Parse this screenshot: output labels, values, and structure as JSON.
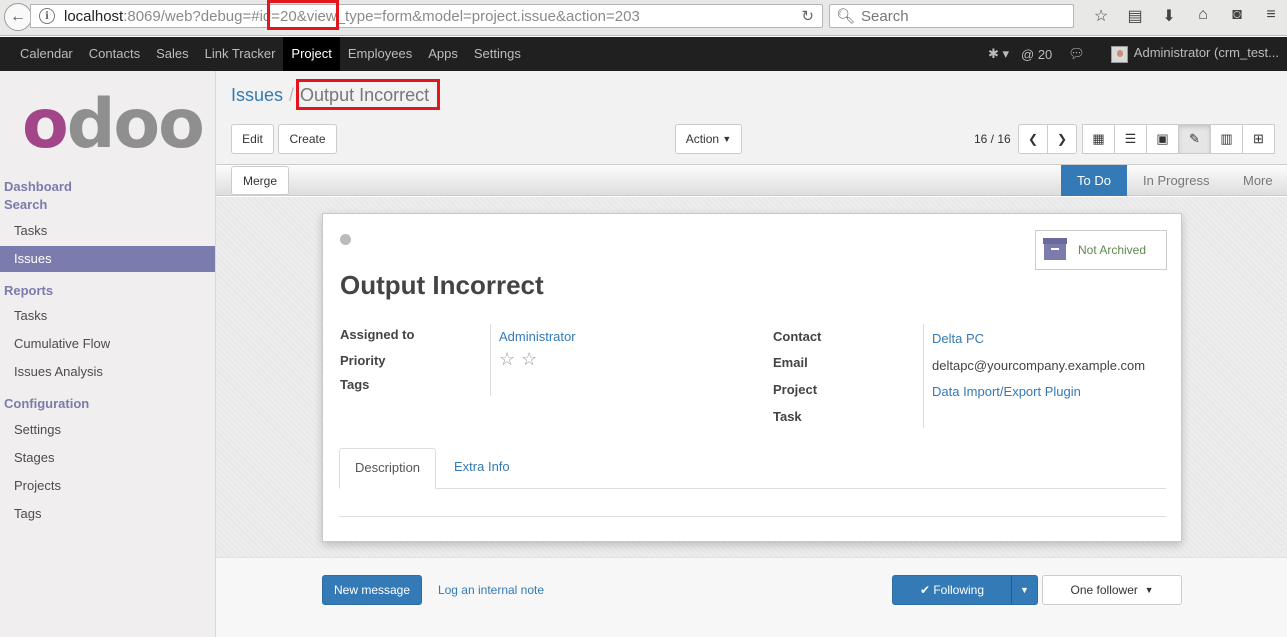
{
  "browser": {
    "url_host": "localhost",
    "url_rest": ":8069/web?debug=#id=20&view_type=form&model=project.issue&action=203",
    "search_placeholder": "Search"
  },
  "topnav": {
    "items": [
      "Calendar",
      "Contacts",
      "Sales",
      "Link Tracker",
      "Project",
      "Employees",
      "Apps",
      "Settings"
    ],
    "active": "Project",
    "message_count": "20",
    "user": "Administrator (crm_test..."
  },
  "sidebar": {
    "logo_first": "o",
    "logo_rest": "doo",
    "dashboard": "Dashboard",
    "search": "Search",
    "search_items": [
      "Tasks",
      "Issues"
    ],
    "reports": "Reports",
    "report_items": [
      "Tasks",
      "Cumulative Flow",
      "Issues Analysis"
    ],
    "configuration": "Configuration",
    "config_items": [
      "Settings",
      "Stages",
      "Projects",
      "Tags"
    ]
  },
  "breadcrumb": {
    "parent": "Issues",
    "sep": "/",
    "current": "Output Incorrect"
  },
  "buttons": {
    "edit": "Edit",
    "create": "Create",
    "action": "Action",
    "merge": "Merge"
  },
  "pager": "16 / 16",
  "stages": [
    "To Do",
    "In Progress",
    "More"
  ],
  "record": {
    "archive_label": "Not Archived",
    "title": "Output Incorrect",
    "labels": {
      "assigned_to": "Assigned to",
      "priority": "Priority",
      "tags": "Tags",
      "contact": "Contact",
      "email": "Email",
      "project": "Project",
      "task": "Task"
    },
    "assigned_to": "Administrator",
    "contact": "Delta PC",
    "email": "deltapc@yourcompany.example.com",
    "project": "Data Import/Export Plugin",
    "tabs": [
      "Description",
      "Extra Info"
    ]
  },
  "chatter": {
    "new_message": "New message",
    "log_note": "Log an internal note",
    "following": "Following",
    "followers": "One follower"
  }
}
